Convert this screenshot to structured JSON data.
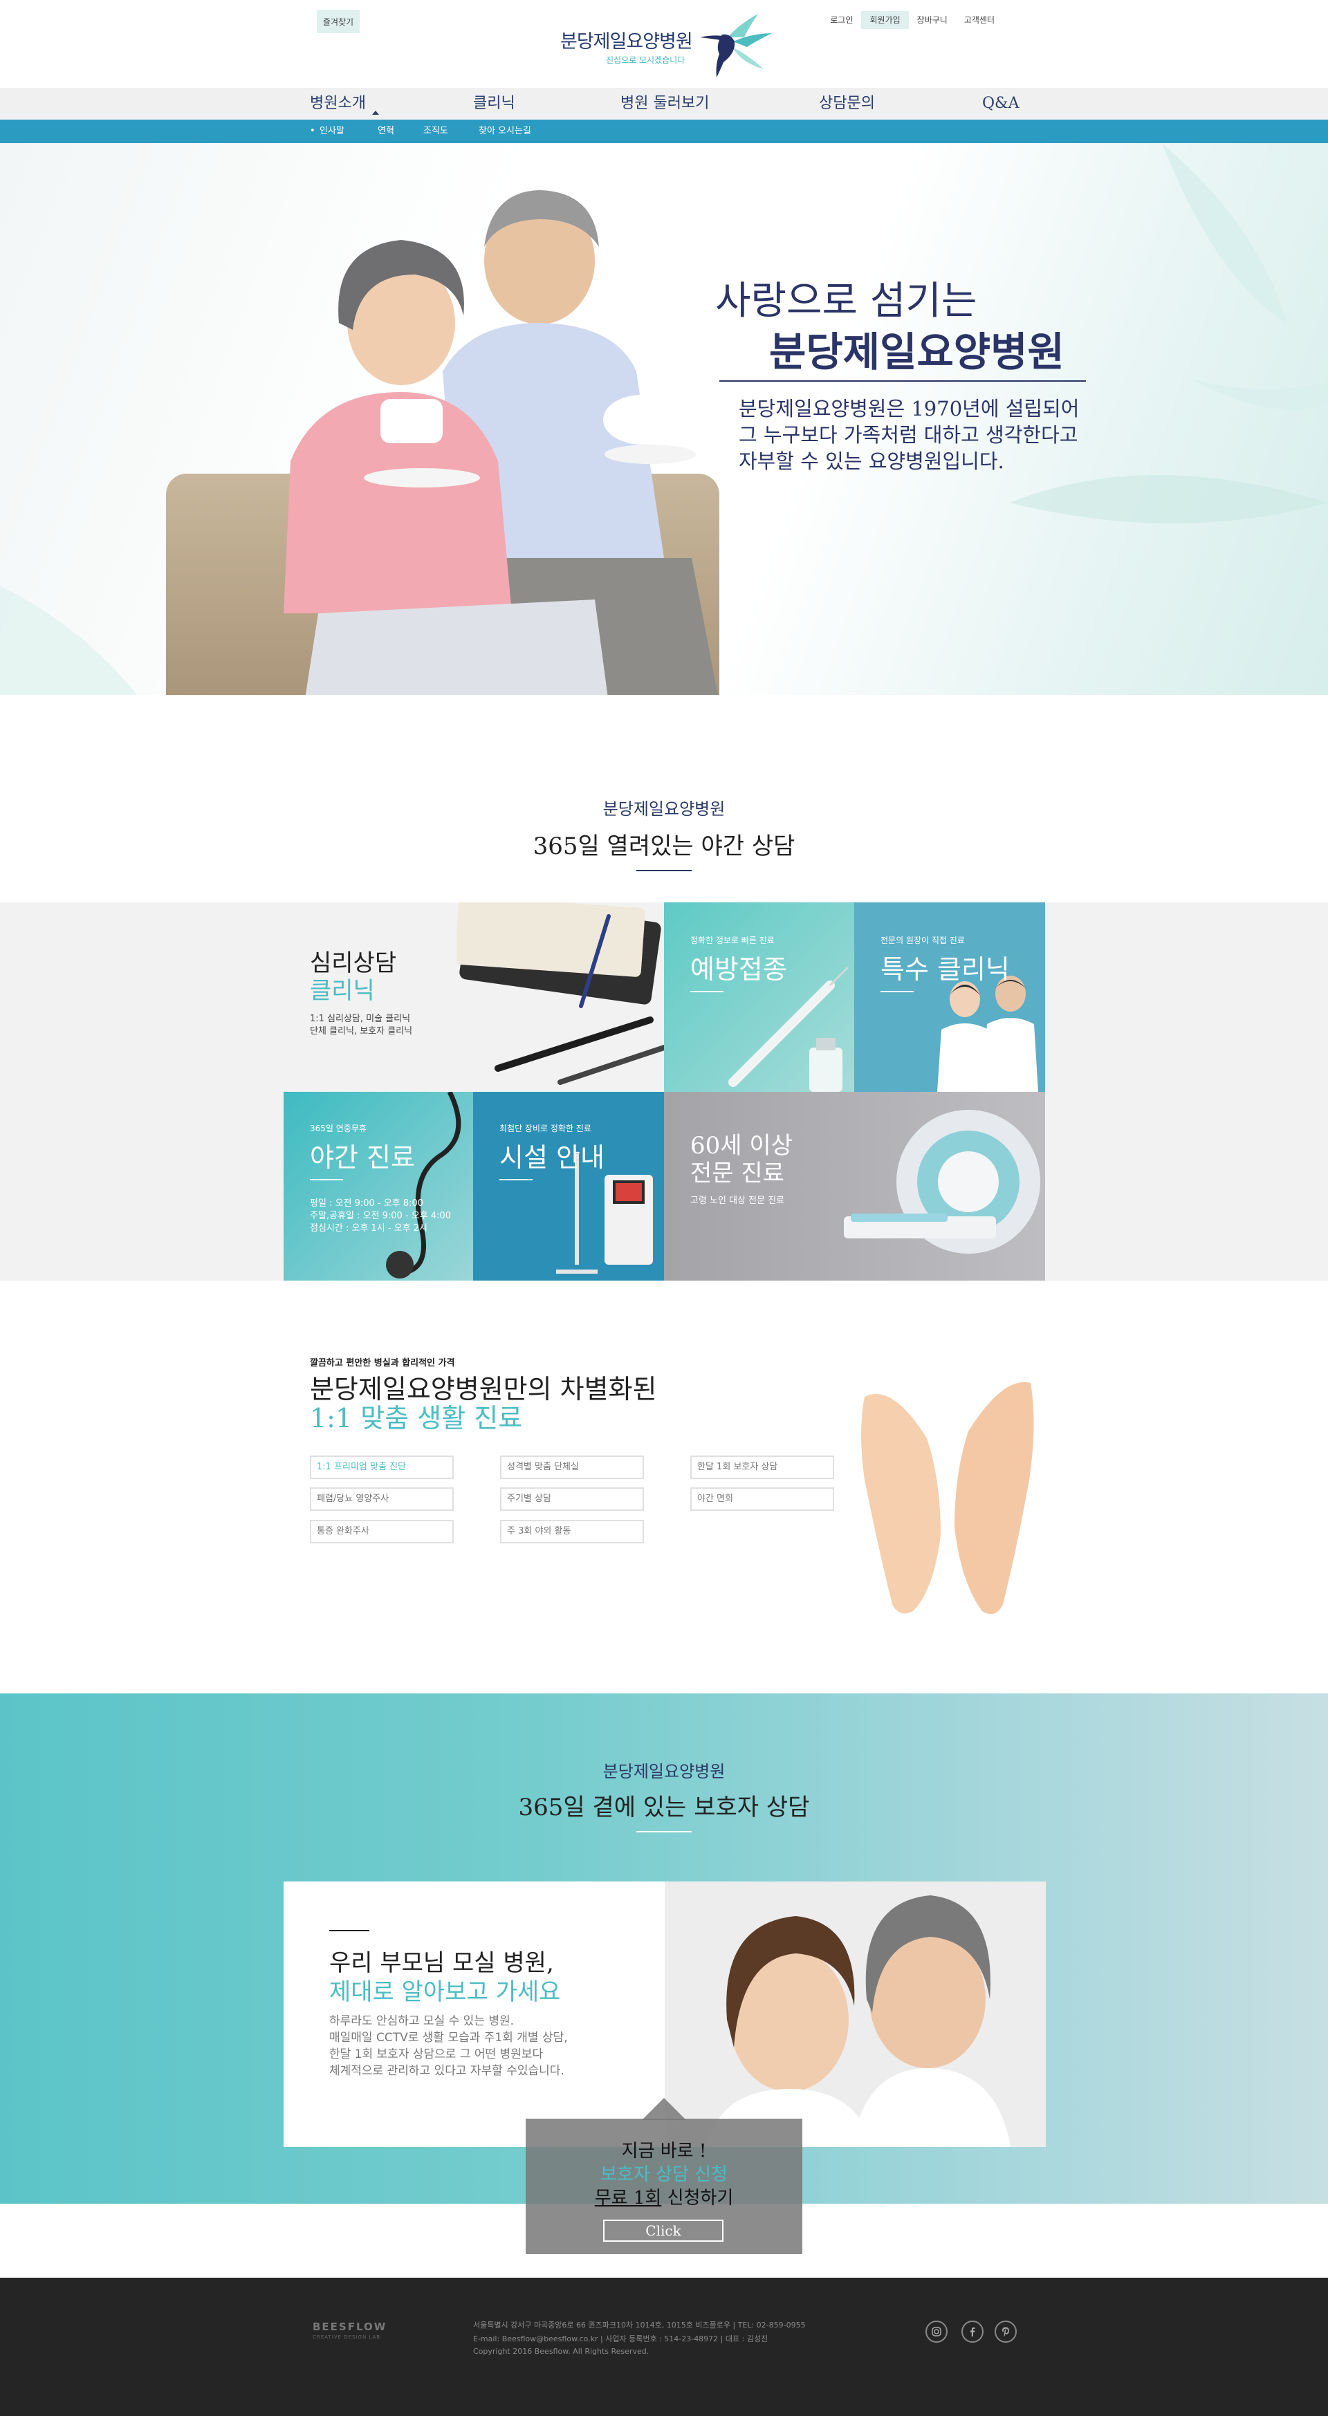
{
  "header": {
    "bookmark_label": "즐겨찾기",
    "logo_title": "분당제일요양병원",
    "logo_subtitle": "진심으로 모시겠습니다",
    "top_links": [
      {
        "label": "로그인"
      },
      {
        "label": "회원가입"
      },
      {
        "label": "장바구니"
      },
      {
        "label": "고객센터"
      }
    ]
  },
  "nav": {
    "items": [
      {
        "label": "병원소개"
      },
      {
        "label": "클리닉"
      },
      {
        "label": "병원 둘러보기"
      },
      {
        "label": "상담문의"
      },
      {
        "label": "Q&A"
      }
    ],
    "sub_items": [
      {
        "label": "인사말"
      },
      {
        "label": "연혁"
      },
      {
        "label": "조직도"
      },
      {
        "label": "찾아 오시는길"
      }
    ]
  },
  "hero": {
    "title_line1": "사랑으로 섬기는",
    "title_line2": "분당제일요양병원",
    "desc_line1": "분당제일요양병원은 1970년에 설립되어",
    "desc_line2": "그 누구보다 가족처럼 대하고 생각한다고",
    "desc_line3": "자부할 수 있는 요양병원입니다."
  },
  "night_section": {
    "small": "분당제일요양병원",
    "title": "365일 열려있는 야간 상담"
  },
  "tiles": {
    "psych": {
      "title1": "심리상담",
      "title2": "클리닉",
      "desc1": "1:1 심리상담, 미술 클리닉",
      "desc2": "단체 클리닉, 보호자 클리닉"
    },
    "vaccine": {
      "small": "정확한 정보로 빠른 진료",
      "title": "예방접종"
    },
    "special": {
      "small": "전문의 원장이 직접 진료",
      "title": "특수 클리닉"
    },
    "night": {
      "small": "365일 연중무휴",
      "title": "야간 진료",
      "line1": "평일 : 오전 9:00 - 오후 8:00",
      "line2": "주말,공휴일 : 오전 9:00 - 오후 4:00",
      "line3": "점심시간 : 오후 1시 - 오후 2시"
    },
    "facility": {
      "small": "최첨단 장비로 정확한 진료",
      "title": "시설 안내"
    },
    "senior": {
      "title1": "60세 이상",
      "title2": "전문 진료",
      "desc": "고령 노인 대상 전문 진료"
    }
  },
  "custom_section": {
    "small": "깔끔하고 편안한 병실과 합리적인 가격",
    "title1": "분당제일요양병원만의 차별화된",
    "title2": "1:1 맞춤 생활 진료",
    "tags": [
      {
        "label": "1:1 프리미엄 맞춤 진단"
      },
      {
        "label": "성격별 맞춤 단체실"
      },
      {
        "label": "한달 1회 보호자 상담"
      },
      {
        "label": "폐렴/당뇨 영양주사"
      },
      {
        "label": "주기별 상담"
      },
      {
        "label": "야간 면회"
      },
      {
        "label": "통증 완화주사"
      },
      {
        "label": "주 3회 야외 활동"
      }
    ]
  },
  "guardian_section": {
    "small": "분당제일요양병원",
    "title": "365일 곁에 있는 보호자 상담",
    "card_title1": "우리 부모님 모실 병원,",
    "card_title2": "제대로 알아보고 가세요",
    "card_desc": [
      "하루라도 안심하고 모실 수 있는 병원.",
      "매일매일 CCTV로 생활 모습과 주1회 개별 상담,",
      "한달 1회 보호자 상담으로 그 어떤 병원보다",
      "체계적으로 관리하고 있다고 자부할 수있습니다."
    ]
  },
  "cta": {
    "line1": "지금 바로 !",
    "line2": "보호자 상담 신청",
    "line3_underlined": "무료 1회",
    "line3_rest": " 신청하기",
    "button": "Click"
  },
  "footer": {
    "brand": "BEESFLOW",
    "brand_sub": "CREATIVE DESIGN LAB",
    "address": "서울특별시 강서구 마곡중앙6로 66 퀸즈파크10차 1014호, 1015호 비즈플로우 | TEL: 02-859-0955",
    "email_line": "E-mail: Beesflow@beesflow.co.kr | 사업자 등록번호 : 514-23-48972 | 대표 : 김성진",
    "copyright": "Copyright 2016 Beesflow. All Rights Reserved.",
    "social_icons": [
      "instagram-icon",
      "facebook-icon",
      "pinterest-icon"
    ]
  },
  "colors": {
    "navy": "#2a3466",
    "teal": "#4cbcc4",
    "subnav": "#2c9bc2",
    "footer": "#252525"
  }
}
